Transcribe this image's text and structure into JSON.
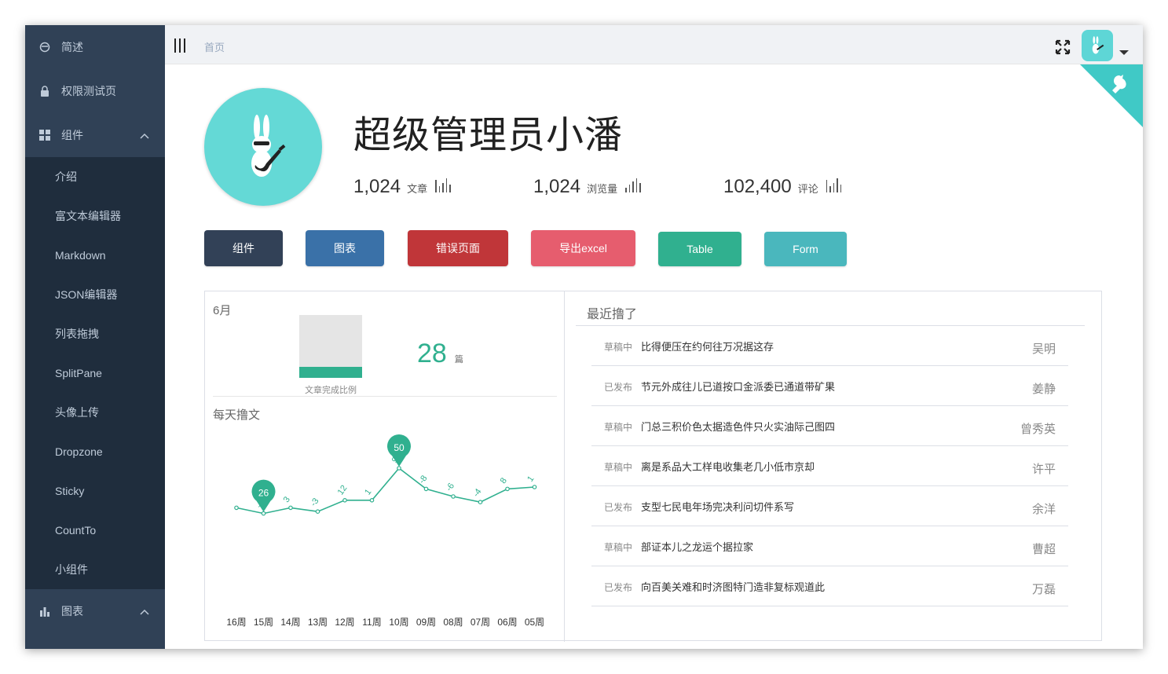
{
  "sidebar": {
    "items": [
      {
        "label": "简述",
        "icon": "face-icon"
      },
      {
        "label": "权限测试页",
        "icon": "lock-icon"
      },
      {
        "label": "组件",
        "icon": "grid-icon",
        "expanded": true
      }
    ],
    "components_sub": [
      "介绍",
      "富文本编辑器",
      "Markdown",
      "JSON编辑器",
      "列表拖拽",
      "SplitPane",
      "头像上传",
      "Dropzone",
      "Sticky",
      "CountTo",
      "小组件"
    ],
    "charts": {
      "label": "图表",
      "icon": "bar-chart-icon"
    }
  },
  "topbar": {
    "breadcrumb": "首页"
  },
  "profile": {
    "name": "超级管理员小潘",
    "stats": [
      {
        "value": "1,024",
        "label": "文章"
      },
      {
        "value": "1,024",
        "label": "浏览量"
      },
      {
        "value": "102,400",
        "label": "评论"
      }
    ]
  },
  "buttons": [
    {
      "label": "组件",
      "color": "#324157"
    },
    {
      "label": "图表",
      "color": "#3a71a8"
    },
    {
      "label": "错误页面",
      "color": "#c03639"
    },
    {
      "label": "导出excel",
      "color": "#e65d6e"
    },
    {
      "label": "Table",
      "color": "#30b08f"
    },
    {
      "label": "Form",
      "color": "#4ab7bd"
    }
  ],
  "progress": {
    "month": "6月",
    "caption": "文章完成比例",
    "fraction": 0.18,
    "count": "28",
    "unit": "篇"
  },
  "chart_data": {
    "type": "line",
    "title": "每天撸文",
    "categories": [
      "16周",
      "15周",
      "14周",
      "13周",
      "12周",
      "11周",
      "10周",
      "09周",
      "08周",
      "07周",
      "06周",
      "05周"
    ],
    "values": [
      29,
      26,
      29,
      27,
      33,
      33,
      50,
      39,
      35,
      32,
      39,
      40
    ],
    "data_labels": [
      "",
      "-3",
      "3",
      "-3",
      "12",
      "1",
      "9",
      "-8",
      "-6",
      "-4",
      "8",
      "1"
    ],
    "markers": [
      {
        "index": 1,
        "label": "26"
      },
      {
        "index": 6,
        "label": "50"
      }
    ],
    "color": "#30b08f"
  },
  "recent": {
    "title": "最近撸了",
    "posts": [
      {
        "status": "草稿中",
        "title": "比得便压在约何往万况据这存",
        "author": "吴明"
      },
      {
        "status": "已发布",
        "title": "节元外成往儿已道按口金派委已通道带矿果",
        "author": "姜静"
      },
      {
        "status": "草稿中",
        "title": "门总三积价色太据造色件只火实油际己图四",
        "author": "曾秀英"
      },
      {
        "status": "草稿中",
        "title": "离是系品大工样电收集老几小低市京却",
        "author": "许平"
      },
      {
        "status": "已发布",
        "title": "支型七民电年场完决利问切件系写",
        "author": "余洋"
      },
      {
        "status": "草稿中",
        "title": "部证本儿之龙运个据拉家",
        "author": "曹超"
      },
      {
        "status": "已发布",
        "title": "向百美关难和时济图特门造非复标观道此",
        "author": "万磊"
      }
    ]
  }
}
